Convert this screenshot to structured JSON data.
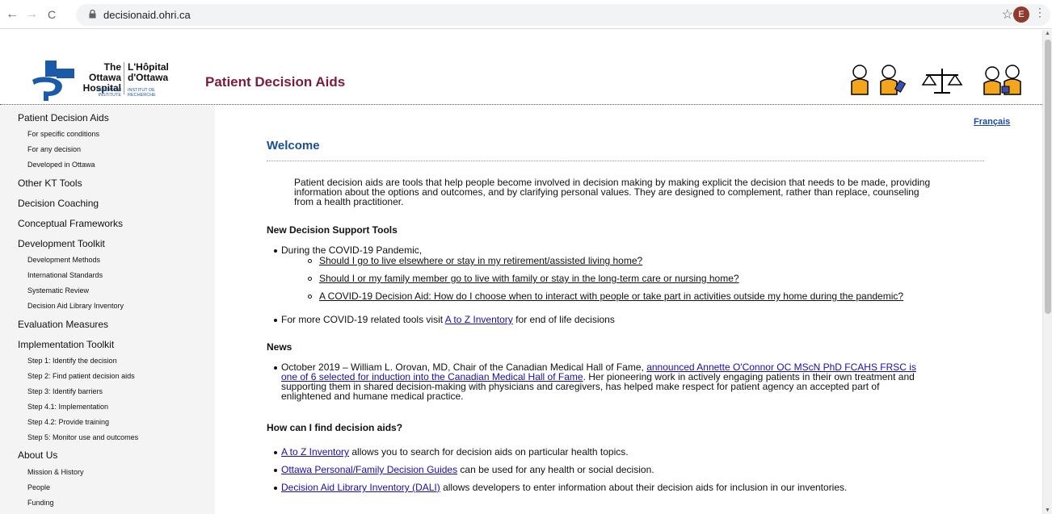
{
  "browser": {
    "back": "←",
    "forward": "→",
    "reload": "C",
    "url": "decisionaid.ohri.ca",
    "star": "☆",
    "avatar_letter": "E",
    "menu": "⋮"
  },
  "header": {
    "logo_en_top": "The Ottawa",
    "logo_en_bottom": "Hospital",
    "logo_fr_top": "L'Hôpital",
    "logo_fr_bottom": "d'Ottawa",
    "logo_en_small_1": "RESEARCH",
    "logo_en_small_2": "INSTITUTE",
    "logo_fr_small_1": "INSTITUT DE",
    "logo_fr_small_2": "RECHERCHE",
    "site_title": "Patient Decision Aids"
  },
  "sidebar": {
    "s1": "Patient Decision Aids",
    "s1a": "For specific conditions",
    "s1b": "For any decision",
    "s1c": "Developed in Ottawa",
    "s2": "Other KT Tools",
    "s3": "Decision Coaching",
    "s4": "Conceptual Frameworks",
    "s5": "Development Toolkit",
    "s5a": "Development Methods",
    "s5b": "International Standards",
    "s5c": "Systematic Review",
    "s5d": "Decision Aid Library Inventory",
    "s6": "Evaluation Measures",
    "s7": "Implementation Toolkit",
    "s7a": "Step 1: Identify the decision",
    "s7b": "Step 2: Find patient decision aids",
    "s7c": "Step 3: Identify barriers",
    "s7d": "Step 4.1: Implementation",
    "s7e": "Step 4.2: Provide training",
    "s7f": "Step 5: Monitor use and outcomes",
    "s8": "About Us",
    "s8a": "Mission & History",
    "s8b": "People",
    "s8c": "Funding"
  },
  "content": {
    "lang": "Français",
    "welcome": "Welcome",
    "intro_1": "Patient decision aids are tools that help people become involved in decision making by making explicit the decision that needs to be made, providing",
    "intro_2": "information about the options and outcomes, and by clarifying personal values. They are designed to complement, rather than replace, counseling",
    "intro_3": "from a health practitioner.",
    "h_new": "New Decision Support Tools",
    "covid_lead": "During the COVID-19 Pandemic,",
    "covid_link_1": "Should I go to live elsewhere or stay in my retirement/assisted living home?",
    "covid_link_2": "Should I or my family member go to live with family or stay in the long-term care or nursing home?",
    "covid_link_3": "A COVID-19 Decision Aid: How do I choose when to interact with people or take part in activities outside my home during the pandemic?",
    "more_pre": "For more COVID-19 related tools visit ",
    "more_link": "A to Z Inventory",
    "more_post": " for end of life decisions",
    "h_news": "News",
    "news_pre": "October 2019 – William L. Orovan, MD, Chair of the Canadian Medical Hall of Fame, ",
    "news_link_1": "announced Annette O'Connor OC MScN PhD FCAHS FRSC is",
    "news_link_2": "one of 6 selected for induction into the Canadian Medical Hall of Fame",
    "news_post_1": ". Her pioneering work in actively engaging patients in their own treatment and",
    "news_post_2": "supporting them in shared decision-making with physicians and caregivers, has helped make respect for patient agency an accepted part of",
    "news_post_3": "enlightened and humane medical practice.",
    "h_find": "How can I find decision aids?",
    "find_1_link": "A to Z Inventory",
    "find_1_text": " allows you to search for decision aids on particular health topics.",
    "find_2_link": "Ottawa Personal/Family Decision Guides",
    "find_2_text": " can be used for any health or social decision.",
    "find_3_link": "Decision Aid Library Inventory (DALI)",
    "find_3_text": " allows developers to enter information about their decision aids for inclusion in our inventories."
  }
}
